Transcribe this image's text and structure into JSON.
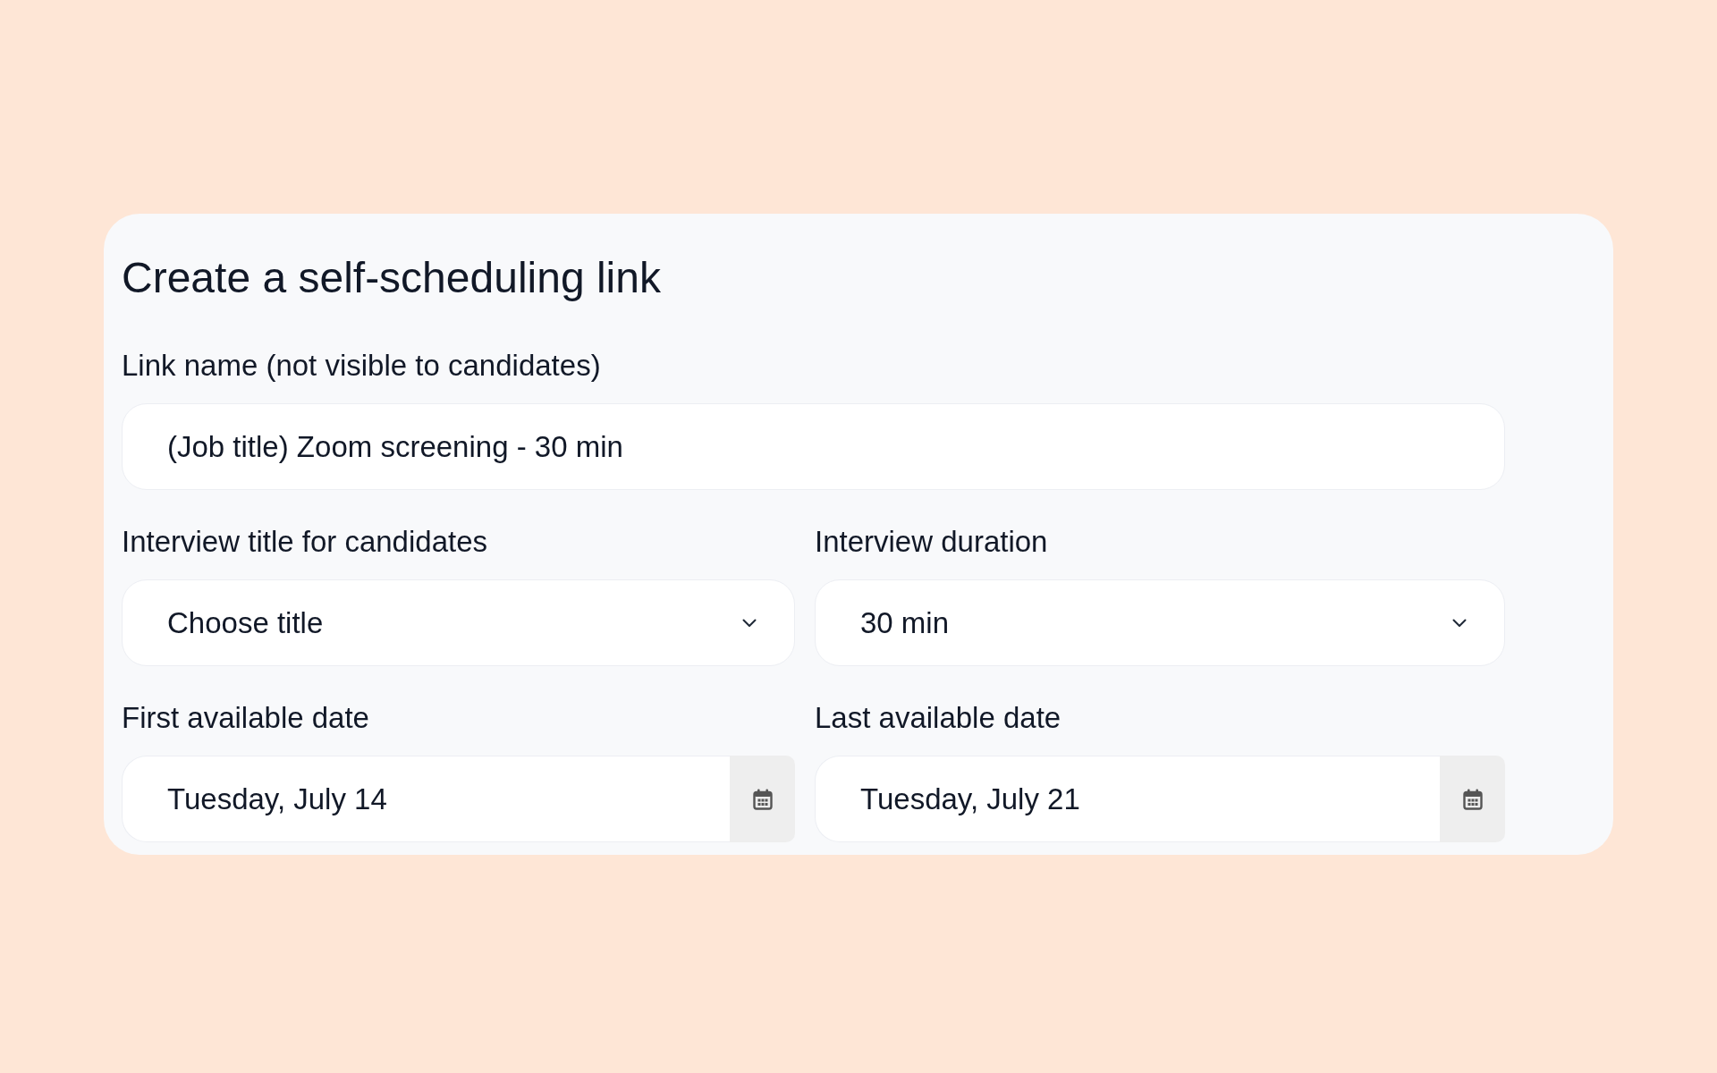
{
  "form": {
    "title": "Create a self-scheduling link",
    "rows": [
      {
        "fields": [
          {
            "kind": "text",
            "label": "Link name (not visible to candidates)",
            "value": "(Job title) Zoom screening - 30 min"
          }
        ]
      },
      {
        "fields": [
          {
            "kind": "select",
            "label": "Interview title for candidates",
            "placeholder": "Choose title"
          },
          {
            "kind": "select",
            "label": "Interview duration",
            "value": "30 min"
          }
        ]
      },
      {
        "fields": [
          {
            "kind": "date",
            "label": "First available date",
            "value": "Tuesday, July 14"
          },
          {
            "kind": "date",
            "label": "Last available date",
            "value": "Tuesday, July 21"
          }
        ]
      }
    ]
  }
}
